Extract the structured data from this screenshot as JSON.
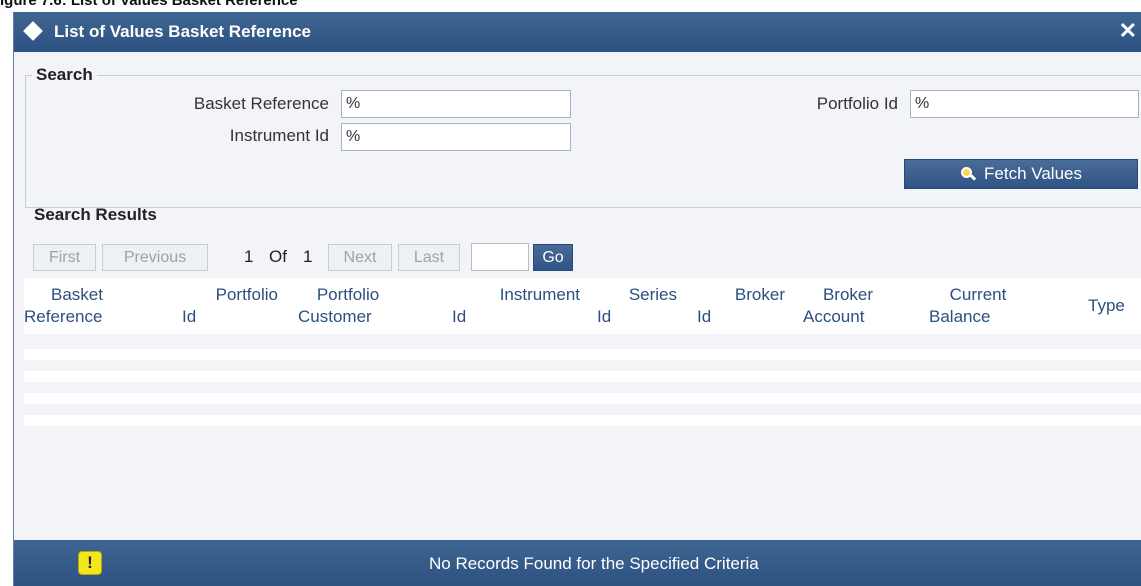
{
  "caption": "igure 7.6: List of Values Basket Reference",
  "dialog": {
    "title": "List of Values Basket Reference",
    "close_label": "✕"
  },
  "search": {
    "legend": "Search",
    "basket_reference_label": "Basket Reference",
    "basket_reference_value": "%",
    "instrument_id_label": "Instrument Id",
    "instrument_id_value": "%",
    "portfolio_id_label": "Portfolio Id",
    "portfolio_id_value": "%",
    "fetch_label": "Fetch Values"
  },
  "results": {
    "heading": "Search Results",
    "pager": {
      "first": "First",
      "previous": "Previous",
      "current_page": "1",
      "of_label": "Of",
      "total_pages": "1",
      "next": "Next",
      "last": "Last",
      "go": "Go"
    },
    "columns": [
      {
        "line1": "Basket",
        "line2": "Reference"
      },
      {
        "line1": "Portfolio",
        "line2": "Id"
      },
      {
        "line1": "Portfolio",
        "line2": "Customer"
      },
      {
        "line1": "Instrument",
        "line2": "Id"
      },
      {
        "line1": "Series",
        "line2": "Id"
      },
      {
        "line1": "Broker",
        "line2": "Id"
      },
      {
        "line1": "Broker",
        "line2": "Account"
      },
      {
        "line1": "Current",
        "line2": "Balance"
      },
      {
        "line1": "Type",
        "line2": ""
      }
    ]
  },
  "status": {
    "icon": "warning-icon",
    "message": "No Records Found for the Specified Criteria"
  },
  "colors": {
    "titlebar": "#2d5282",
    "header_text": "#2c4f80",
    "warning": "#f3e61c"
  }
}
